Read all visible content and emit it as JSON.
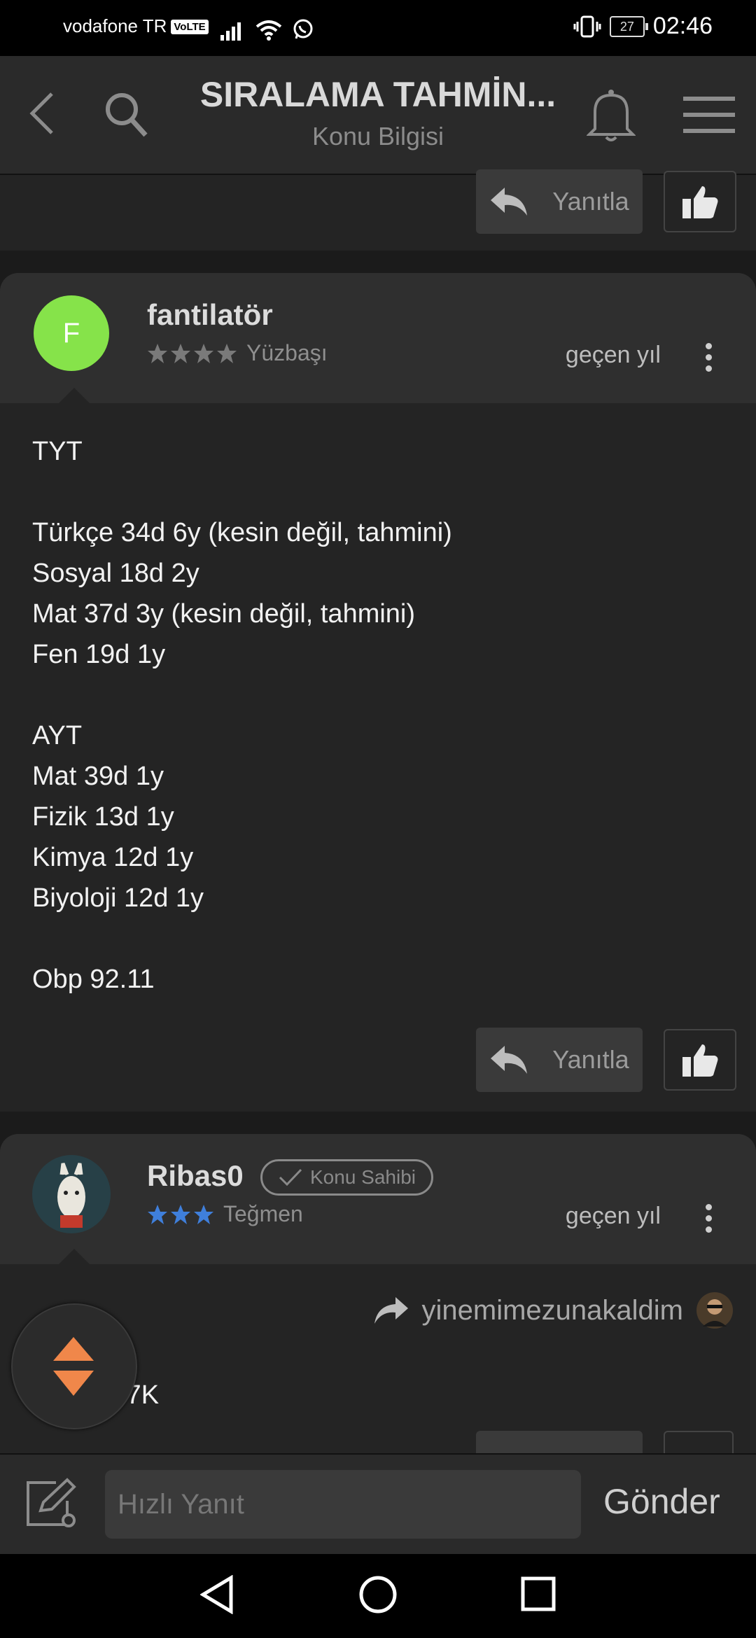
{
  "status_bar": {
    "carrier": "vodafone TR",
    "volte": "VoLTE",
    "battery": "27",
    "time": "02:46"
  },
  "header": {
    "title": "SIRALAMA TAHMİN...",
    "subtitle": "Konu Bilgisi"
  },
  "actions": {
    "reply_label": "Yanıtla"
  },
  "posts": [
    {
      "avatar_letter": "F",
      "username": "fantilatör",
      "rank": "Yüzbaşı",
      "stars": 4,
      "time": "geçen yıl",
      "body": "TYT\n\nTürkçe 34d 6y (kesin değil, tahmini)\nSosyal 18d 2y\nMat 37d 3y (kesin değil, tahmini)\nFen 19d 1y\n\nAYT\nMat 39d 1y\nFizik 13d 1y\nKimya 12d 1y\nBiyoloji 12d 1y\n\nObp 92.11"
    },
    {
      "username": "Ribas0",
      "badge": "Konu Sahibi",
      "rank": "Teğmen",
      "stars": 3,
      "time": "geçen yıl",
      "quoted_user": "yinemimezunakaldim",
      "body_partial": ".7K"
    }
  ],
  "composer": {
    "placeholder": "Hızlı Yanıt",
    "send_label": "Gönder"
  },
  "colors": {
    "avatar_green": "#86e34a",
    "accent_orange": "#f0874a",
    "star_blue": "#3f7fdb"
  }
}
